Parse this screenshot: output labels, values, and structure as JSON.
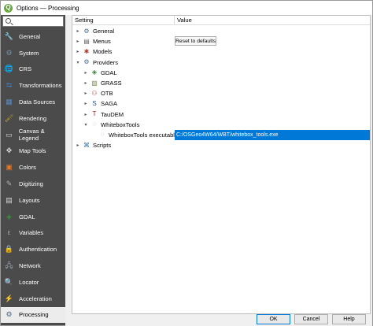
{
  "window": {
    "title": "Options — Processing"
  },
  "search": {
    "placeholder": "",
    "value": ""
  },
  "sidebar": {
    "items": [
      {
        "label": "General",
        "icon": "wrench-icon",
        "color": "#8a8a8a",
        "glyph": "🔧"
      },
      {
        "label": "System",
        "icon": "system-icon",
        "color": "#6b8fb5",
        "glyph": "⚙"
      },
      {
        "label": "CRS",
        "icon": "globe-icon",
        "color": "#3b7bbf",
        "glyph": "🌐"
      },
      {
        "label": "Transformations",
        "icon": "transform-icon",
        "color": "#3b7bbf",
        "glyph": "⇆"
      },
      {
        "label": "Data Sources",
        "icon": "table-icon",
        "color": "#5c87b8",
        "glyph": "▦"
      },
      {
        "label": "Rendering",
        "icon": "paintbrush-icon",
        "color": "#c9a227",
        "glyph": "🖌"
      },
      {
        "label": "Canvas & Legend",
        "icon": "canvas-icon",
        "color": "#d9d9d9",
        "glyph": "▭"
      },
      {
        "label": "Map Tools",
        "icon": "map-tools-icon",
        "color": "#d9d9d9",
        "glyph": "✥"
      },
      {
        "label": "Colors",
        "icon": "palette-icon",
        "color": "#e07a2a",
        "glyph": "▣"
      },
      {
        "label": "Digitizing",
        "icon": "pencil-icon",
        "color": "#b0b0b0",
        "glyph": "✎"
      },
      {
        "label": "Layouts",
        "icon": "layout-icon",
        "color": "#d9d9d9",
        "glyph": "▤"
      },
      {
        "label": "GDAL",
        "icon": "gdal-icon",
        "color": "#3e8e3e",
        "glyph": "◈"
      },
      {
        "label": "Variables",
        "icon": "variables-icon",
        "color": "#9d9d9d",
        "glyph": "ε"
      },
      {
        "label": "Authentication",
        "icon": "lock-icon",
        "color": "#e0b020",
        "glyph": "🔒"
      },
      {
        "label": "Network",
        "icon": "network-icon",
        "color": "#9aa7b8",
        "glyph": "🖧"
      },
      {
        "label": "Locator",
        "icon": "locator-icon",
        "color": "#8c8c8c",
        "glyph": "🔍"
      },
      {
        "label": "Acceleration",
        "icon": "acceleration-icon",
        "color": "#5b5b5b",
        "glyph": "⚡"
      },
      {
        "label": "Processing",
        "icon": "processing-gear-icon",
        "color": "#4b6d8e",
        "glyph": "⚙"
      }
    ],
    "active_index": 17
  },
  "table": {
    "headers": {
      "setting": "Setting",
      "value": "Value"
    },
    "rows": [
      {
        "label": "General",
        "level": 0,
        "arrow": "▸",
        "icon": "gear-icon",
        "glyph": "⚙",
        "icon_color": "#4a6f95"
      },
      {
        "label": "Menus",
        "level": 0,
        "arrow": "▸",
        "icon": "menu-icon",
        "glyph": "▤",
        "icon_color": "#666666",
        "value_button": "Reset to defaults"
      },
      {
        "label": "Models",
        "level": 0,
        "arrow": "▸",
        "icon": "models-icon",
        "glyph": "✱",
        "icon_color": "#b03a2e"
      },
      {
        "label": "Providers",
        "level": 0,
        "arrow": "▾",
        "icon": "gear-icon",
        "glyph": "⚙",
        "icon_color": "#4a6f95"
      },
      {
        "label": "GDAL",
        "level": 1,
        "arrow": "▸",
        "icon": "gdal-icon",
        "glyph": "◈",
        "icon_color": "#2f7d32"
      },
      {
        "label": "GRASS",
        "level": 1,
        "arrow": "▸",
        "icon": "grass-icon",
        "glyph": "▨",
        "icon_color": "#7a8a5a"
      },
      {
        "label": "OTB",
        "level": 1,
        "arrow": "▸",
        "icon": "otb-icon",
        "glyph": "⚇",
        "icon_color": "#c0392b"
      },
      {
        "label": "SAGA",
        "level": 1,
        "arrow": "▸",
        "icon": "saga-icon",
        "glyph": "S",
        "icon_color": "#1f4e9b"
      },
      {
        "label": "TauDEM",
        "level": 1,
        "arrow": "▸",
        "icon": "taudem-icon",
        "glyph": "T",
        "icon_color": "#a01818"
      },
      {
        "label": "WhiteboxTools",
        "level": 1,
        "arrow": "▾",
        "icon": "whitebox-icon",
        "glyph": "◌",
        "icon_color": "#9a9a9a"
      },
      {
        "label": "WhiteboxTools executable",
        "level": 2,
        "arrow": "",
        "icon": "whitebox-icon",
        "glyph": "◌",
        "icon_color": "#9a9a9a",
        "value_path": "C:/OSGeo4W64/WBT/whitebox_tools.exe"
      },
      {
        "label": "Scripts",
        "level": 0,
        "arrow": "▸",
        "icon": "python-icon",
        "glyph": "⌘",
        "icon_color": "#3572a5"
      }
    ]
  },
  "buttons": {
    "ok": "OK",
    "cancel": "Cancel",
    "help": "Help"
  },
  "colors": {
    "sidebar_bg": "#4b4b4b",
    "selection": "#0078d7",
    "active_item_bg": "#ececec"
  }
}
